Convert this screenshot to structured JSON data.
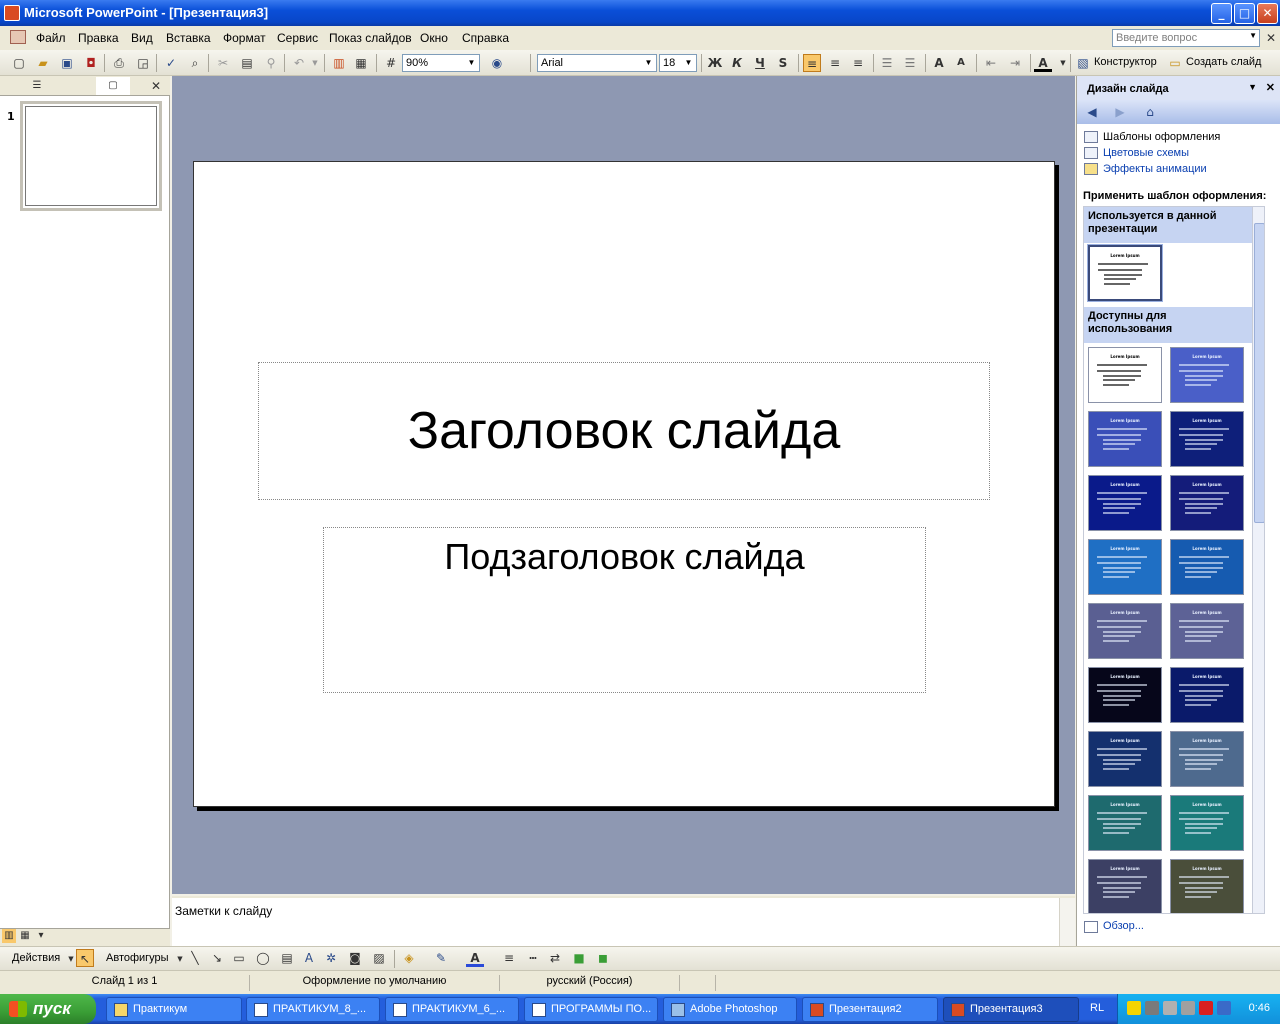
{
  "window": {
    "title": "Microsoft PowerPoint - [Презентация3]",
    "controls": {
      "minimize": "_",
      "maximize": "□",
      "close": "✕"
    }
  },
  "menu": {
    "items": [
      "Файл",
      "Правка",
      "Вид",
      "Вставка",
      "Формат",
      "Сервис",
      "Показ слайдов",
      "Окно",
      "Справка"
    ],
    "help_placeholder": "Введите вопрос"
  },
  "toolbar": {
    "zoom": "90%",
    "font": "Arial",
    "font_size": "18",
    "bold": "Ж",
    "italic": "К",
    "underline": "Ч",
    "shadow": "S",
    "designer_label": "Конструктор",
    "new_slide_label": "Создать слайд"
  },
  "left_panel": {
    "outline_tab_icon": "outline-icon",
    "slides_tab_icon": "slides-icon",
    "slide_number": "1"
  },
  "slide": {
    "title": "Заголовок слайда",
    "subtitle": "Подзаголовок слайда"
  },
  "notes": {
    "placeholder": "Заметки к слайду"
  },
  "task_pane": {
    "title": "Дизайн слайда",
    "links": [
      "Шаблоны оформления",
      "Цветовые схемы",
      "Эффекты анимации"
    ],
    "apply_label": "Применить шаблон оформления:",
    "used_header": "Используется в данной презентации",
    "available_header": "Доступны для использования",
    "browse": "Обзор...",
    "template_text": "Lorem Ipsum",
    "template_colors": [
      "#ffffff",
      "#4a5fc8",
      "#3a4fb8",
      "#0e1f7a",
      "#0a1a8a",
      "#141c7a",
      "#1f6fc4",
      "#165bb0",
      "#5a5f92",
      "#5d6296",
      "#06061a",
      "#0a1a6a",
      "#14306e",
      "#4e6a8e",
      "#1e6a6e",
      "#1a7a7a",
      "#3c4064",
      "#4a4e3a"
    ]
  },
  "drawing_bar": {
    "actions": "Действия",
    "autoshapes": "Автофигуры"
  },
  "status": {
    "slide": "Слайд 1 из 1",
    "design": "Оформление по умолчанию",
    "language": "русский (Россия)"
  },
  "taskbar": {
    "start": "пуск",
    "buttons": [
      "Практикум",
      "ПРАКТИКУМ_8_...",
      "ПРАКТИКУМ_6_...",
      "ПРОГРАММЫ ПО...",
      "Adobe Photoshop",
      "Презентация2",
      "Презентация3"
    ],
    "language": "RL",
    "clock": "0:46"
  }
}
